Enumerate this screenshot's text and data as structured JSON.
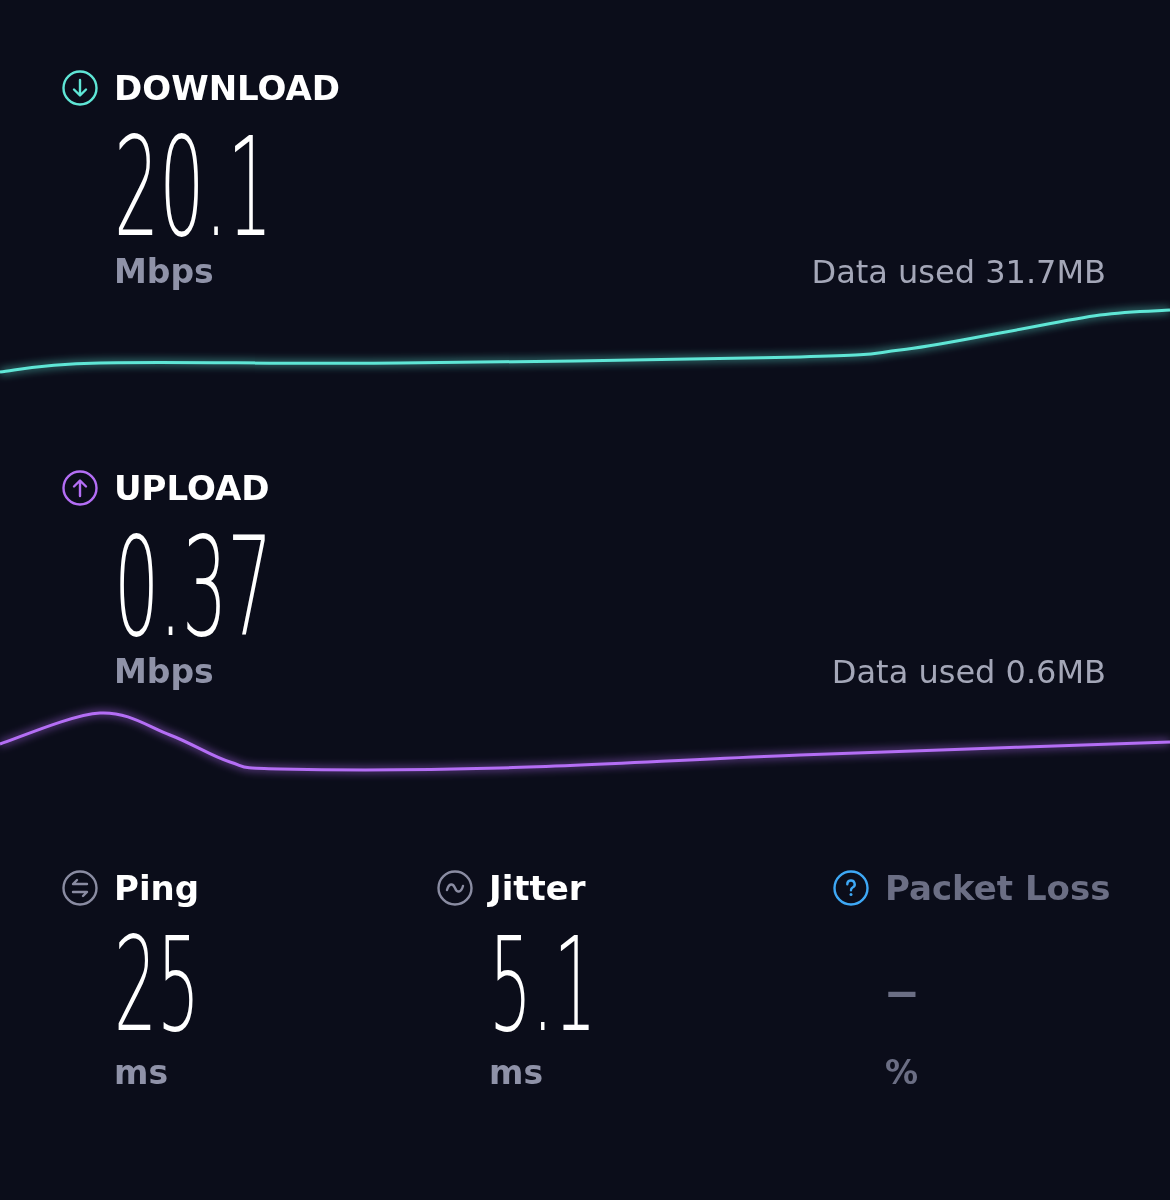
{
  "tests": [
    {
      "kind": "download",
      "label": "DOWNLOAD",
      "color": "#5fe6d6",
      "value": "20.1",
      "unit": "Mbps",
      "data_used": "Data used 31.7MB"
    },
    {
      "kind": "upload",
      "label": "UPLOAD",
      "color": "#b46ef5",
      "value": "0.37",
      "unit": "Mbps",
      "data_used": "Data used 0.6MB"
    }
  ],
  "metrics": [
    {
      "kind": "ping",
      "label": "Ping",
      "color": "#8a8ca2",
      "value": "25",
      "unit": "ms",
      "available": true
    },
    {
      "kind": "jitter",
      "label": "Jitter",
      "color": "#8a8ca2",
      "value": "5.1",
      "unit": "ms",
      "available": true
    },
    {
      "kind": "packet_loss",
      "label": "Packet Loss",
      "color": "#3ea8f5",
      "value": "–",
      "unit": "%",
      "available": false
    }
  ]
}
